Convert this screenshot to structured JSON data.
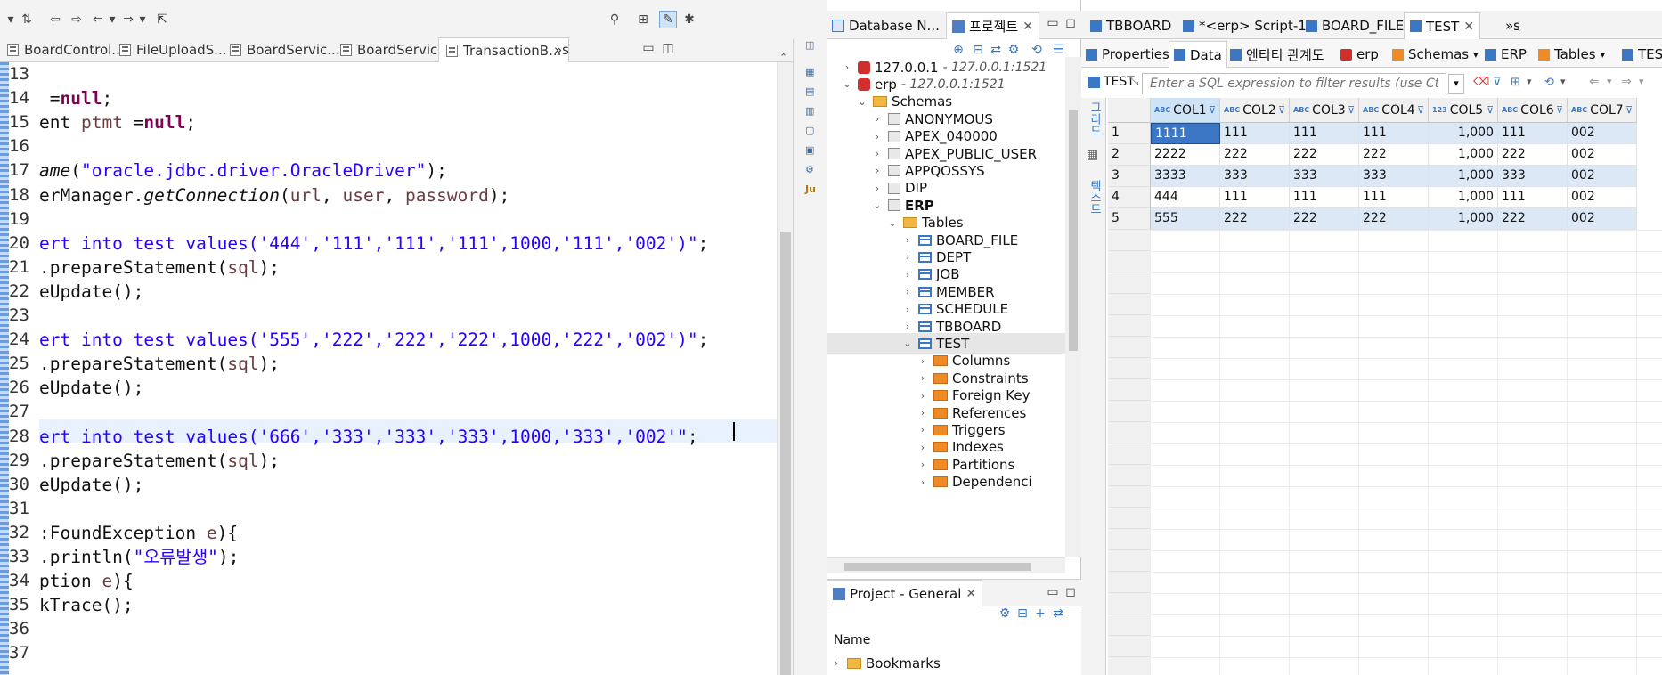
{
  "editor": {
    "tabs": [
      "BoardControl...",
      "FileUploadS...",
      "BoardServic...",
      "BoardServic...",
      "TransactionB..."
    ],
    "overflow_tab": "»s",
    "line_numbers": [
      "13",
      "14",
      "15",
      "16",
      "17",
      "18",
      "19",
      "20",
      "21",
      "22",
      "23",
      "24",
      "25",
      "26",
      "27",
      "28",
      "29",
      "30",
      "31",
      "32",
      "33",
      "34",
      "35",
      "36",
      "37"
    ],
    "lines": [
      [],
      [
        {
          "t": " =",
          "c": ""
        },
        {
          "t": "null",
          "c": "kw"
        },
        {
          "t": ";",
          "c": ""
        }
      ],
      [
        {
          "t": "ent ",
          "c": ""
        },
        {
          "t": "ptmt",
          "c": "var"
        },
        {
          "t": " =",
          "c": ""
        },
        {
          "t": "null",
          "c": "kw"
        },
        {
          "t": ";",
          "c": ""
        }
      ],
      [],
      [
        {
          "t": "ame",
          "c": "it"
        },
        {
          "t": "(",
          "c": ""
        },
        {
          "t": "\"oracle.jdbc.driver.OracleDriver\"",
          "c": "str"
        },
        {
          "t": ");",
          "c": ""
        }
      ],
      [
        {
          "t": "erManager.",
          "c": ""
        },
        {
          "t": "getConnection",
          "c": "it"
        },
        {
          "t": "(",
          "c": ""
        },
        {
          "t": "url",
          "c": "var"
        },
        {
          "t": ", ",
          "c": ""
        },
        {
          "t": "user",
          "c": "var"
        },
        {
          "t": ", ",
          "c": ""
        },
        {
          "t": "password",
          "c": "var"
        },
        {
          "t": ");",
          "c": ""
        }
      ],
      [],
      [
        {
          "t": "ert into test values('444','111','111','111',1000,'111','002')\"",
          "c": "str"
        },
        {
          "t": ";",
          "c": ""
        }
      ],
      [
        {
          "t": ".prepareStatement(",
          "c": ""
        },
        {
          "t": "sql",
          "c": "var"
        },
        {
          "t": ");",
          "c": ""
        }
      ],
      [
        {
          "t": "eUpdate();",
          "c": ""
        }
      ],
      [],
      [
        {
          "t": "ert into test values('555','222','222','222',1000,'222','002')\"",
          "c": "str"
        },
        {
          "t": ";",
          "c": ""
        }
      ],
      [
        {
          "t": ".prepareStatement(",
          "c": ""
        },
        {
          "t": "sql",
          "c": "var"
        },
        {
          "t": ");",
          "c": ""
        }
      ],
      [
        {
          "t": "eUpdate();",
          "c": ""
        }
      ],
      [],
      [
        {
          "t": "ert into test values('666','333','333','333',1000,'333','002",
          "c": "str"
        },
        {
          "t": "'\"",
          "c": "str"
        },
        {
          "t": ";",
          "c": ""
        }
      ],
      [
        {
          "t": ".prepareStatement(",
          "c": ""
        },
        {
          "t": "sql",
          "c": "var"
        },
        {
          "t": ");",
          "c": ""
        }
      ],
      [
        {
          "t": "eUpdate();",
          "c": ""
        }
      ],
      [],
      [
        {
          "t": ":FoundException ",
          "c": ""
        },
        {
          "t": "e",
          "c": "var"
        },
        {
          "t": "){",
          "c": ""
        }
      ],
      [
        {
          "t": ".println(",
          "c": ""
        },
        {
          "t": "\"오류발생\"",
          "c": "str"
        },
        {
          "t": ");",
          "c": ""
        }
      ],
      [
        {
          "t": "ption ",
          "c": ""
        },
        {
          "t": "e",
          "c": "var"
        },
        {
          "t": "){",
          "c": ""
        }
      ],
      [
        {
          "t": "kTrace();",
          "c": ""
        }
      ],
      [],
      []
    ]
  },
  "navigator": {
    "tab_db": "Database N...",
    "tab_project": "프로젝트",
    "tree": [
      {
        "label": "127.0.0.1",
        "host": "- 127.0.0.1:1521",
        "icon": "conn",
        "indent": 0,
        "arrow": "›"
      },
      {
        "label": "erp",
        "host": "- 127.0.0.1:1521",
        "icon": "conn",
        "indent": 0,
        "arrow": "⌄"
      },
      {
        "label": "Schemas",
        "icon": "folder",
        "indent": 1,
        "arrow": "⌄"
      },
      {
        "label": "ANONYMOUS",
        "icon": "schema",
        "indent": 2,
        "arrow": "›"
      },
      {
        "label": "APEX_040000",
        "icon": "schema",
        "indent": 2,
        "arrow": "›"
      },
      {
        "label": "APEX_PUBLIC_USER",
        "icon": "schema",
        "indent": 2,
        "arrow": "›"
      },
      {
        "label": "APPQOSSYS",
        "icon": "schema",
        "indent": 2,
        "arrow": "›"
      },
      {
        "label": "DIP",
        "icon": "schema",
        "indent": 2,
        "arrow": "›"
      },
      {
        "label": "ERP",
        "icon": "schema",
        "indent": 2,
        "arrow": "⌄",
        "bold": true
      },
      {
        "label": "Tables",
        "icon": "folder",
        "indent": 3,
        "arrow": "⌄"
      },
      {
        "label": "BOARD_FILE",
        "icon": "table",
        "indent": 4,
        "arrow": "›"
      },
      {
        "label": "DEPT",
        "icon": "table",
        "indent": 4,
        "arrow": "›"
      },
      {
        "label": "JOB",
        "icon": "table",
        "indent": 4,
        "arrow": "›"
      },
      {
        "label": "MEMBER",
        "icon": "table",
        "indent": 4,
        "arrow": "›"
      },
      {
        "label": "SCHEDULE",
        "icon": "table",
        "indent": 4,
        "arrow": "›"
      },
      {
        "label": "TBBOARD",
        "icon": "table",
        "indent": 4,
        "arrow": "›"
      },
      {
        "label": "TEST",
        "icon": "table",
        "indent": 4,
        "arrow": "⌄",
        "selected": true
      },
      {
        "label": "Columns",
        "icon": "orfolder",
        "indent": 5,
        "arrow": "›"
      },
      {
        "label": "Constraints",
        "icon": "orfolder",
        "indent": 5,
        "arrow": "›"
      },
      {
        "label": "Foreign Key",
        "icon": "orfolder",
        "indent": 5,
        "arrow": "›"
      },
      {
        "label": "References",
        "icon": "orfolder",
        "indent": 5,
        "arrow": "›"
      },
      {
        "label": "Triggers",
        "icon": "orfolder",
        "indent": 5,
        "arrow": "›"
      },
      {
        "label": "Indexes",
        "icon": "orfolder",
        "indent": 5,
        "arrow": "›"
      },
      {
        "label": "Partitions",
        "icon": "orfolder",
        "indent": 5,
        "arrow": "›"
      },
      {
        "label": "Dependenci",
        "icon": "orfolder",
        "indent": 5,
        "arrow": "›"
      }
    ],
    "project_panel_title": "Project - General",
    "project_col_name": "Name",
    "project_item": "Bookmarks"
  },
  "data_editor": {
    "top_tabs": [
      "TBBOARD",
      "*<erp> Script-1",
      "BOARD_FILE",
      "TEST"
    ],
    "top_overflow": "»s",
    "sub_tabs": [
      "Properties",
      "Data",
      "엔티티 관계도",
      "erp",
      "Schemas",
      "ERP",
      "Tables",
      "TES"
    ],
    "table_label": "TEST",
    "filter_placeholder": "Enter a SQL expression to filter results (use Ct",
    "side_tabs": [
      "그리드",
      "텍스트"
    ],
    "columns": [
      {
        "name": "COL1",
        "type": "ABC"
      },
      {
        "name": "COL2",
        "type": "ABC"
      },
      {
        "name": "COL3",
        "type": "ABC"
      },
      {
        "name": "COL4",
        "type": "ABC"
      },
      {
        "name": "COL5",
        "type": "123"
      },
      {
        "name": "COL6",
        "type": "ABC"
      },
      {
        "name": "COL7",
        "type": "ABC"
      }
    ],
    "rows": [
      [
        "1",
        "1111",
        "111",
        "111",
        "111",
        "1,000",
        "111",
        "002"
      ],
      [
        "2",
        "2222",
        "222",
        "222",
        "222",
        "1,000",
        "222",
        "002"
      ],
      [
        "3",
        "3333",
        "333",
        "333",
        "333",
        "1,000",
        "333",
        "002"
      ],
      [
        "4",
        "444",
        "111",
        "111",
        "111",
        "1,000",
        "111",
        "002"
      ],
      [
        "5",
        "555",
        "222",
        "222",
        "222",
        "1,000",
        "222",
        "002"
      ]
    ]
  }
}
